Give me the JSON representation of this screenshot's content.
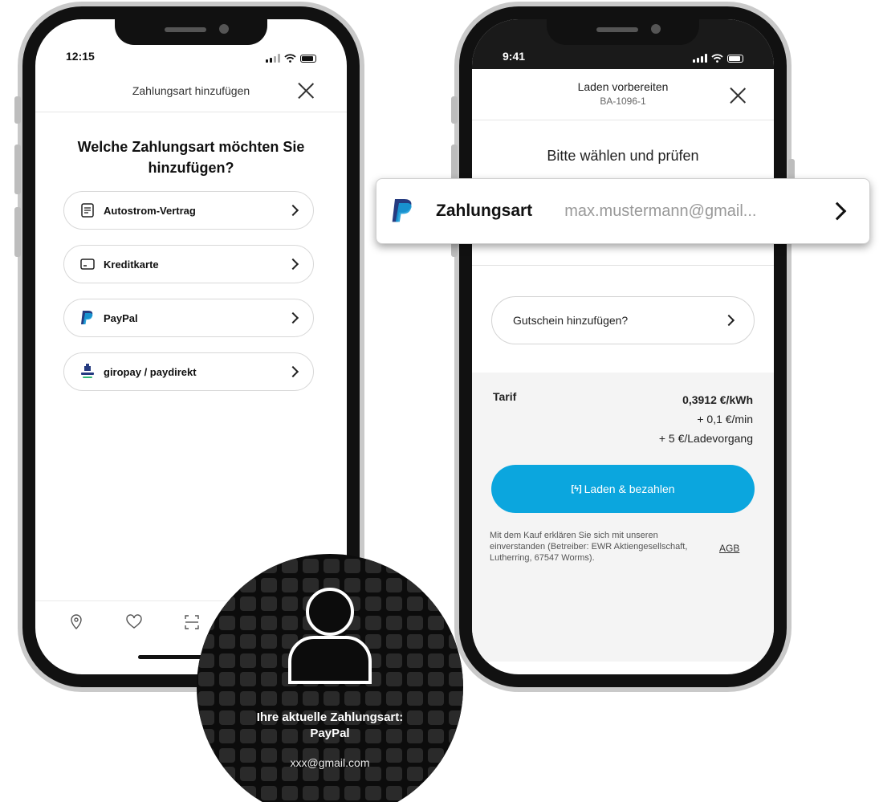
{
  "left_phone": {
    "status_time": "12:15",
    "header_title": "Zahlungsart hinzufügen",
    "question": "Welche Zahlungsart möchten Sie hinzufügen?",
    "options": [
      {
        "label": "Autostrom-Vertrag",
        "icon": "contract-icon"
      },
      {
        "label": "Kreditkarte",
        "icon": "card-icon"
      },
      {
        "label": "PayPal",
        "icon": "paypal-icon"
      },
      {
        "label": "giropay / paydirekt",
        "icon": "giropay-icon"
      }
    ],
    "tabs": [
      "map-pin-icon",
      "heart-icon",
      "scan-icon"
    ]
  },
  "right_phone": {
    "status_time": "9:41",
    "header_title": "Laden vorbereiten",
    "header_subtitle": "BA-1096-1",
    "heading": "Bitte wählen und prüfen",
    "voucher_label": "Gutschein hinzufügen?",
    "tariff_label": "Tarif",
    "tariff_price": "0,3912 €/kWh",
    "tariff_minute": "+ 0,1 €/min",
    "tariff_session": "+ 5 €/Ladevorgang",
    "pay_button_icon": "[ϟ]",
    "pay_button": "Laden & bezahlen",
    "legal": "Mit dem Kauf erklären Sie sich mit unseren einverstanden (Betreiber: EWR Aktiengesellschaft, Lutherring, 67547 Worms).",
    "agb": "AGB"
  },
  "popout": {
    "label": "Zahlungsart",
    "email": "max.mustermann@gmail..."
  },
  "overlay": {
    "title_line1": "Ihre aktuelle Zahlungsart:",
    "title_line2": "PayPal",
    "email": "xxx@gmail.com"
  },
  "colors": {
    "accent": "#0ba6de",
    "paypal_dark": "#253b80",
    "paypal_light": "#179bd7",
    "overlay_bg": "#0c0c0c"
  }
}
